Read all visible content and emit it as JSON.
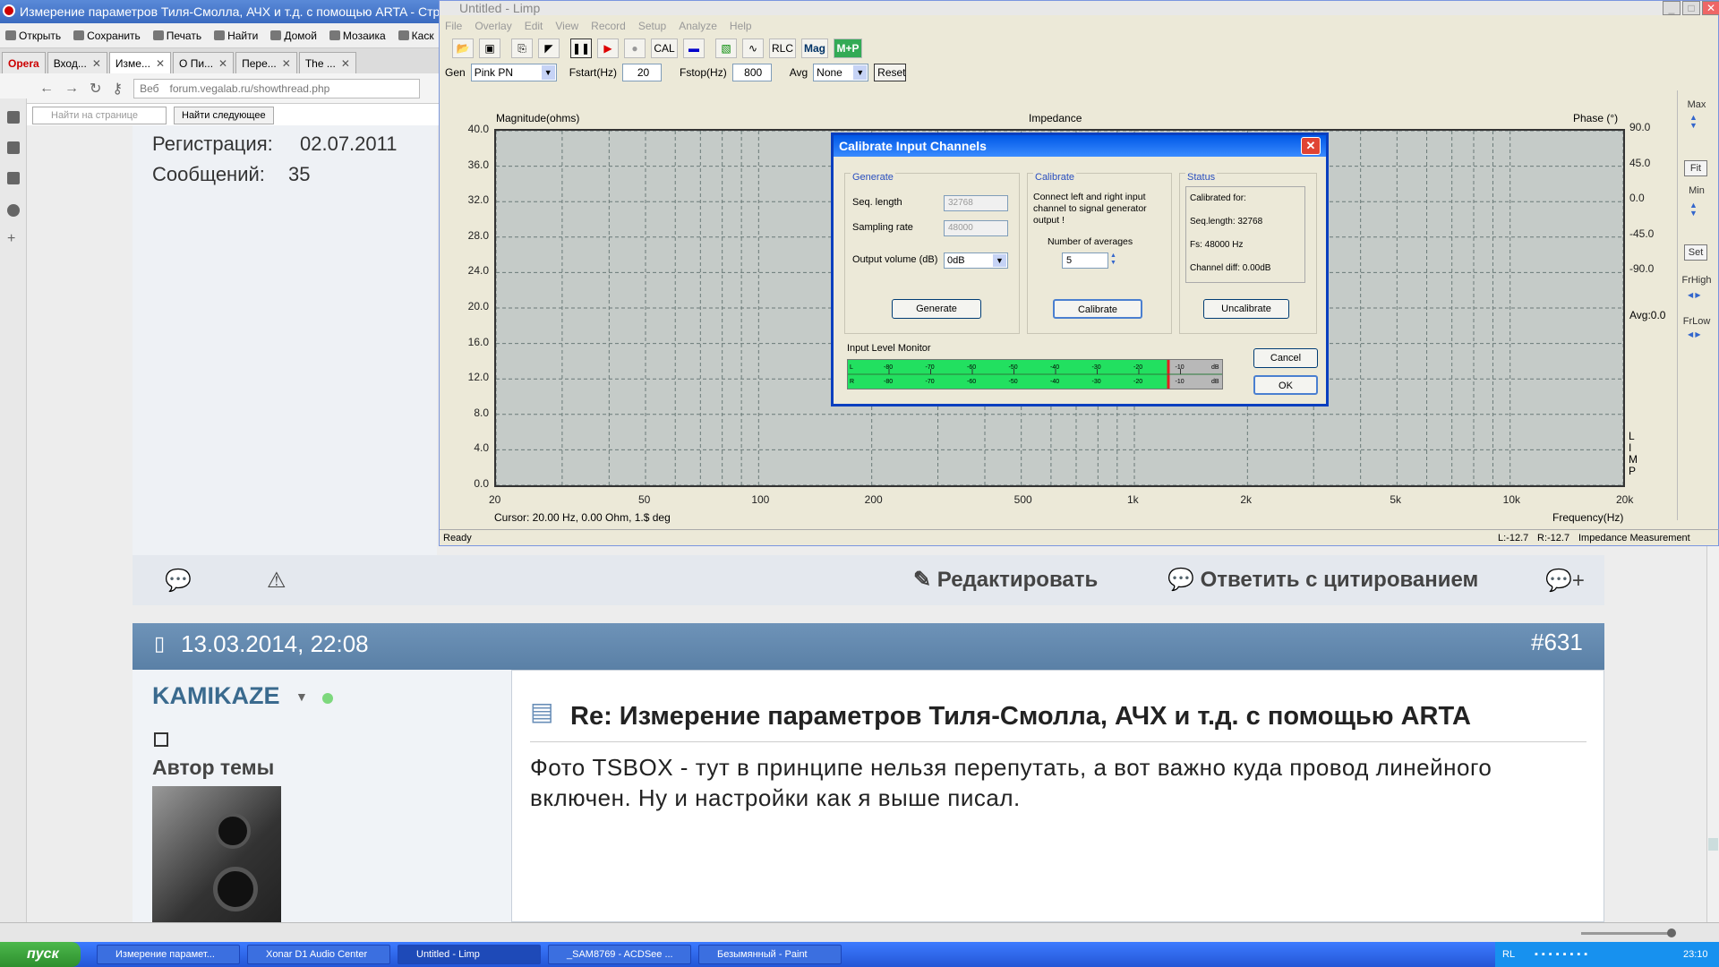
{
  "opera": {
    "title": "Измерение параметров Тиля-Смолла, АЧХ и т.д. с помощью ARTA - Стра",
    "toolbar": [
      "Открыть",
      "Сохранить",
      "Печать",
      "Найти",
      "Домой",
      "Мозаика",
      "Каск"
    ],
    "tabs": [
      "Opera",
      "Вход...",
      "Изме...",
      "О Пи...",
      "Пере...",
      "The ..."
    ],
    "address_prefix": "Веб",
    "address": "forum.vegalab.ru/showthread.php",
    "find_placeholder": "Найти на странице",
    "find_next": "Найти следующее"
  },
  "profile": {
    "reg_label": "Регистрация:",
    "reg_value": "02.07.2011",
    "msgs_label": "Сообщений:",
    "msgs_value": "35"
  },
  "actions": {
    "edit": "Редактировать",
    "quote": "Ответить с цитированием"
  },
  "post": {
    "date": "13.03.2014, 22:08",
    "number": "#631",
    "author": "KAMIKAZE",
    "author_role": "Автор темы",
    "title": "Re: Измерение параметров Тиля-Смолла, АЧХ и т.д. с помощью ARTA",
    "body": "Фото TSBOX - тут в принципе нельзя перепутать, а вот важно куда провод линейного включен. Ну и настройки как я выше писал."
  },
  "limp": {
    "title": "Untitled - Limp",
    "menu": [
      "File",
      "Overlay",
      "Edit",
      "View",
      "Record",
      "Setup",
      "Analyze",
      "Help"
    ],
    "tb_text": [
      "CAL",
      "RLC",
      "Mag",
      "M+P"
    ],
    "gen_label": "Gen",
    "gen_value": "Pink PN",
    "fstart_label": "Fstart(Hz)",
    "fstart_value": "20",
    "fstop_label": "Fstop(Hz)",
    "fstop_value": "800",
    "avg_label": "Avg",
    "avg_value": "None",
    "reset": "Reset",
    "plot_title": "Impedance",
    "y_label": "Magnitude(ohms)",
    "phase_label": "Phase (°)",
    "x_label": "Frequency(Hz)",
    "y_ticks": [
      "40.0",
      "36.0",
      "32.0",
      "28.0",
      "24.0",
      "20.0",
      "16.0",
      "12.0",
      "8.0",
      "4.0",
      "0.0"
    ],
    "phase_ticks": [
      "90.0",
      "45.0",
      "0.0",
      "-45.0",
      "-90.0"
    ],
    "avg_text": "Avg:0.0",
    "x_ticks": [
      "20",
      "50",
      "100",
      "200",
      "500",
      "1k",
      "2k",
      "5k",
      "10k",
      "20k"
    ],
    "cursor": "Cursor: 20.00 Hz, 0.00 Ohm, 1.$ deg",
    "side_labels": [
      "L",
      "I",
      "M",
      "P"
    ],
    "right_panel": {
      "max": "Max",
      "fit": "Fit",
      "min": "Min",
      "set": "Set",
      "frhigh": "FrHigh",
      "frlow": "FrLow"
    },
    "status_ready": "Ready",
    "status_l": "L:-12.7",
    "status_r": "R:-12.7",
    "status_mode": "Impedance Measurement"
  },
  "dialog": {
    "title": "Calibrate Input Channels",
    "generate_group": "Generate",
    "seq_label": "Seq. length",
    "seq_value": "32768",
    "rate_label": "Sampling rate",
    "rate_value": "48000",
    "vol_label": "Output volume (dB)",
    "vol_value": "0dB",
    "generate_btn": "Generate",
    "calibrate_group": "Calibrate",
    "cal_text": "Connect left and right input channel  to  signal generator output !",
    "avg_label": "Number of averages",
    "avg_value": "5",
    "calibrate_btn": "Calibrate",
    "status_group": "Status",
    "status_lines": [
      "Calibrated for:",
      "Seq.length: 32768",
      "Fs: 48000 Hz",
      "Channel diff: 0.00dB"
    ],
    "uncalibrate_btn": "Uncalibrate",
    "monitor_label": "Input Level Monitor",
    "meter_ticks": [
      "-80",
      "-70",
      "-60",
      "-50",
      "-40",
      "-30",
      "-20",
      "-10"
    ],
    "meter_unit": "dB",
    "meter_l": "L",
    "meter_r": "R",
    "level": 0.86,
    "cancel_btn": "Cancel",
    "ok_btn": "OK"
  },
  "taskbar": {
    "start": "пуск",
    "tasks": [
      "Измерение парамет...",
      "Xonar D1 Audio Center",
      "Untitled - Limp",
      "_SAM8769 - ACDSee ...",
      "Безымянный - Paint"
    ],
    "lang": "RL",
    "clock": "23:10"
  }
}
